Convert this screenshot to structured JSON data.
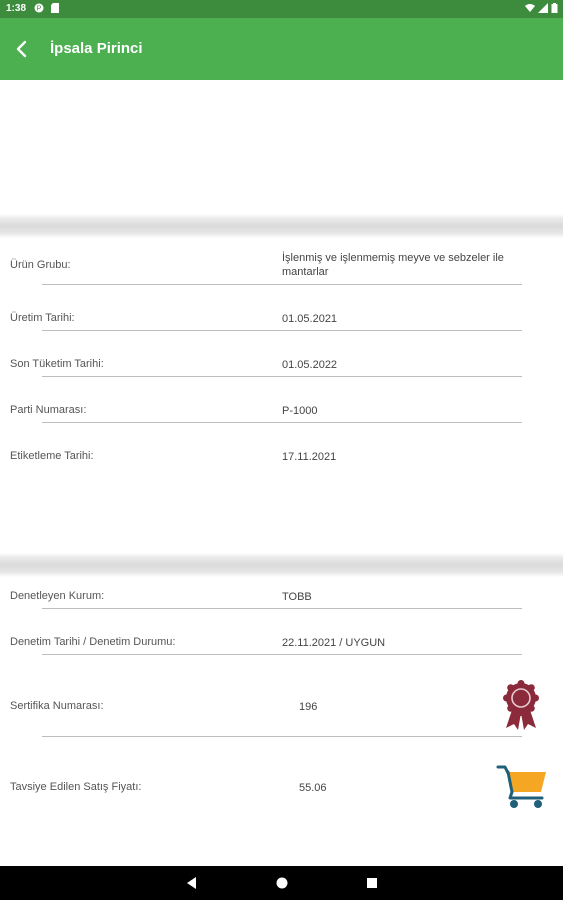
{
  "status_bar": {
    "time": "1:38"
  },
  "app_bar": {
    "title": "İpsala Pirinci"
  },
  "product_info": [
    {
      "label": "Ürün Grubu:",
      "value": "İşlenmiş ve işlenmemiş meyve ve sebzeler ile mantarlar"
    },
    {
      "label": "Üretim Tarihi:",
      "value": "01.05.2021"
    },
    {
      "label": "Son Tüketim Tarihi:",
      "value": "01.05.2022"
    },
    {
      "label": "Parti Numarası:",
      "value": "P-1000"
    },
    {
      "label": "Etiketleme Tarihi:",
      "value": "17.11.2021"
    }
  ],
  "inspection_info": [
    {
      "label": "Denetleyen Kurum:",
      "value": "TOBB"
    },
    {
      "label": "Denetim Tarihi / Denetim Durumu:",
      "value": "22.11.2021 / UYGUN"
    },
    {
      "label": "Sertifika Numarası:",
      "value": "196"
    },
    {
      "label": "Tavsiye Edilen Satış Fiyatı:",
      "value": "55.06"
    }
  ],
  "colors": {
    "status_bar": "#3d8b3d",
    "app_bar": "#4caf50",
    "badge": "#8b2a3a",
    "cart_basket": "#f5a623",
    "cart_frame": "#1f5f7a"
  },
  "icons": {
    "back": "arrow-left-icon",
    "certificate": "award-badge-icon",
    "cart": "shopping-cart-icon"
  }
}
